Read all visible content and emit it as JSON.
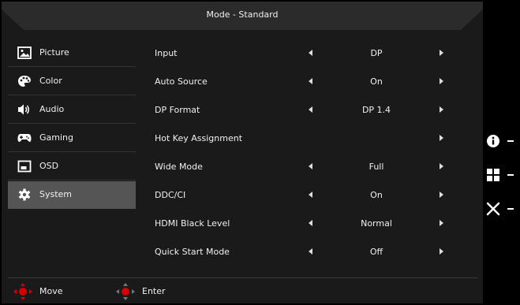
{
  "header": {
    "title": "Mode - Standard"
  },
  "menu": {
    "items": [
      {
        "label": "Picture",
        "icon": "picture-icon",
        "active": false
      },
      {
        "label": "Color",
        "icon": "palette-icon",
        "active": false
      },
      {
        "label": "Audio",
        "icon": "speaker-icon",
        "active": false
      },
      {
        "label": "Gaming",
        "icon": "gamepad-icon",
        "active": false
      },
      {
        "label": "OSD",
        "icon": "osd-window-icon",
        "active": false
      },
      {
        "label": "System",
        "icon": "gear-icon",
        "active": true
      }
    ]
  },
  "settings": {
    "rows": [
      {
        "label": "Input",
        "value": "DP",
        "left_arrow": true,
        "right_arrow": true
      },
      {
        "label": "Auto Source",
        "value": "On",
        "left_arrow": true,
        "right_arrow": true
      },
      {
        "label": "DP Format",
        "value": "DP 1.4",
        "left_arrow": true,
        "right_arrow": true
      },
      {
        "label": "Hot Key Assignment",
        "value": "",
        "left_arrow": false,
        "right_arrow": true
      },
      {
        "label": "Wide Mode",
        "value": "Full",
        "left_arrow": true,
        "right_arrow": true
      },
      {
        "label": "DDC/CI",
        "value": "On",
        "left_arrow": true,
        "right_arrow": true
      },
      {
        "label": "HDMI Black Level",
        "value": "Normal",
        "left_arrow": true,
        "right_arrow": true
      },
      {
        "label": "Quick Start Mode",
        "value": "Off",
        "left_arrow": true,
        "right_arrow": true
      }
    ]
  },
  "footer": {
    "move_label": "Move",
    "enter_label": "Enter",
    "joystick_color": "#d40000"
  },
  "side_buttons": [
    {
      "icon": "info-icon"
    },
    {
      "icon": "grid-icon"
    },
    {
      "icon": "close-icon"
    }
  ],
  "colors": {
    "panel": "#1a1a1a",
    "active": "#555555",
    "header": "#2b2b2b"
  }
}
